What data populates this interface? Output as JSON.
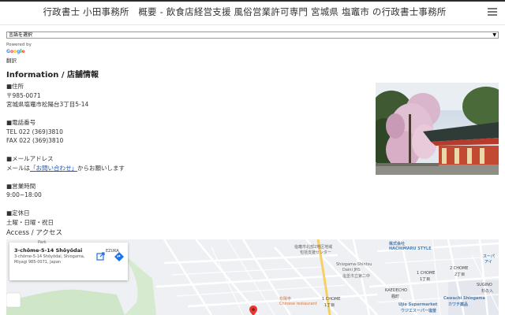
{
  "header": {
    "title": "行政書士 小田事務所　概要 - 飲食店経営支援 風俗営業許可専門 宮城県 塩竈市 の行政書士事務所"
  },
  "translate": {
    "select_value": "言語を選択",
    "powered_by": "Powered by",
    "google_letters": [
      "G",
      "o",
      "o",
      "g",
      "l",
      "e"
    ],
    "link": "翻訳"
  },
  "info": {
    "title": "Information / 店舗情報",
    "address_label": "■住所",
    "postal": "〒985-0071",
    "address": "宮城県塩竈市松陽台3丁目5-14",
    "phone_label": "■電話番号",
    "tel": "TEL 022 (369)3810",
    "fax": "FAX 022 (369)3810",
    "mail_label": "■メールアドレス",
    "mail_prefix": "メールは",
    "mail_link": "「お問い合わせ」",
    "mail_suffix": "からお願いします",
    "hours_label": "■営業時間",
    "hours": "9:00~18:00",
    "holiday_label": "■定休日",
    "holidays": "土曜・日曜・祝日"
  },
  "access": {
    "title": "Access / アクセス"
  },
  "map": {
    "place_name": "3-chōme-5-14 Shōyōdai",
    "place_address": "3-chōme-5-14 Shōyōdai, Shiogama, Miyagi 985-0071, Japan",
    "labels": {
      "ezuka": "EZUKA",
      "park": "Park",
      "north_center": "塩竈市北部2地区地域",
      "north_center2": "包括支援センター",
      "school": "Shiogama-Shintsu",
      "school2": "Daini JHS",
      "school3": "塩釜市立第二中",
      "hachimaru": "株式会社",
      "hachimaru2": "HACHIMARU STYLE",
      "kaedecho": "KAEDECHO",
      "kaedecho_jp": "楓町",
      "chome2": "2 CHOME",
      "chome2_jp": "2丁目",
      "chome1_right": "1 CHOME",
      "chome1_right_jp": "1丁目",
      "chome1": "1 CHOME",
      "chome1_jp": "1丁目",
      "super": "Ujie Supermarket",
      "super_jp": "ウジエスーパー塩釜",
      "cawachi": "Cawachi Shiogama",
      "cawachi_jp": "カワチ薬品",
      "sugino": "SUGINO",
      "sugino_jp": "杉の入",
      "restaurant": "松陽亭",
      "restaurant2": "Chinese restaurant",
      "super_right": "スーパ",
      "super_right2": "アイ"
    }
  },
  "colors": {
    "link": "#1a56c4",
    "header_bar": "#2b2b2b",
    "map_bg": "#eef0f3",
    "pin": "#e53935"
  },
  "icons": {
    "menu": "hamburger-icon",
    "directions": "directions-icon",
    "open_map": "open-in-new-icon",
    "pin": "map-pin-icon"
  }
}
